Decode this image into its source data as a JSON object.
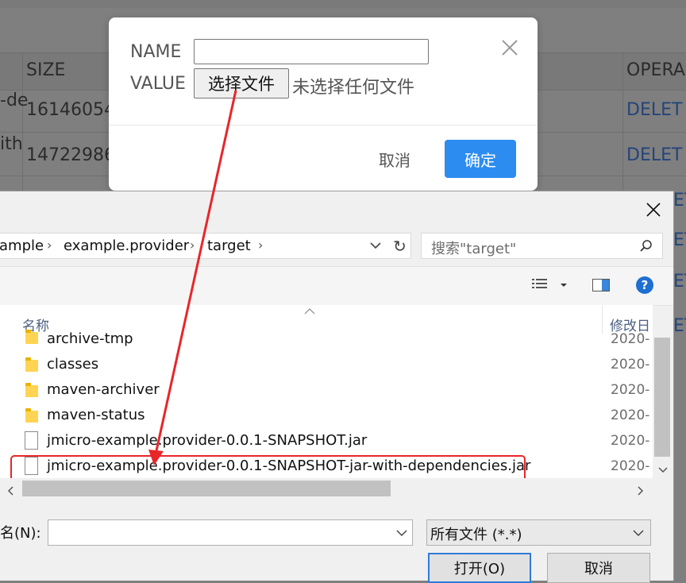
{
  "background_table": {
    "headers": {
      "size": "SIZE",
      "operation": "OPERA"
    },
    "rows": [
      {
        "name_fragment": "-de",
        "size": "16146054",
        "action": "DELET"
      },
      {
        "name_fragment": "ith",
        "size": "14722986",
        "action": "DELET"
      }
    ],
    "more_actions": [
      "ET",
      "ET",
      "ET",
      "ET"
    ]
  },
  "upload_modal": {
    "name_label": "NAME",
    "value_label": "VALUE",
    "name_value": "",
    "choose_file_button": "选择文件",
    "file_status": "未选择任何文件",
    "cancel_button": "取消",
    "confirm_button": "确定",
    "accent_color": "#2d8cf0"
  },
  "file_dialog": {
    "breadcrumbs": [
      "ample",
      "example.provider",
      "target"
    ],
    "search_placeholder": "搜索\"target\"",
    "columns": {
      "name": "名称",
      "date_modified": "修改日"
    },
    "files": [
      {
        "name": "archive-tmp",
        "type": "folder",
        "date": "2020-"
      },
      {
        "name": "classes",
        "type": "folder",
        "date": "2020-"
      },
      {
        "name": "maven-archiver",
        "type": "folder",
        "date": "2020-"
      },
      {
        "name": "maven-status",
        "type": "folder",
        "date": "2020-"
      },
      {
        "name": "jmicro-example.provider-0.0.1-SNAPSHOT.jar",
        "type": "file",
        "date": "2020-"
      },
      {
        "name": "jmicro-example.provider-0.0.1-SNAPSHOT-jar-with-dependencies.jar",
        "type": "file",
        "date": "2020-",
        "highlighted": true
      }
    ],
    "filename_label": "名(N):",
    "filename_value": "",
    "file_type": "所有文件 (*.*)",
    "open_button": "打开(O)",
    "cancel_button": "取消"
  },
  "annotation": {
    "arrow_color": "#e8262a"
  }
}
